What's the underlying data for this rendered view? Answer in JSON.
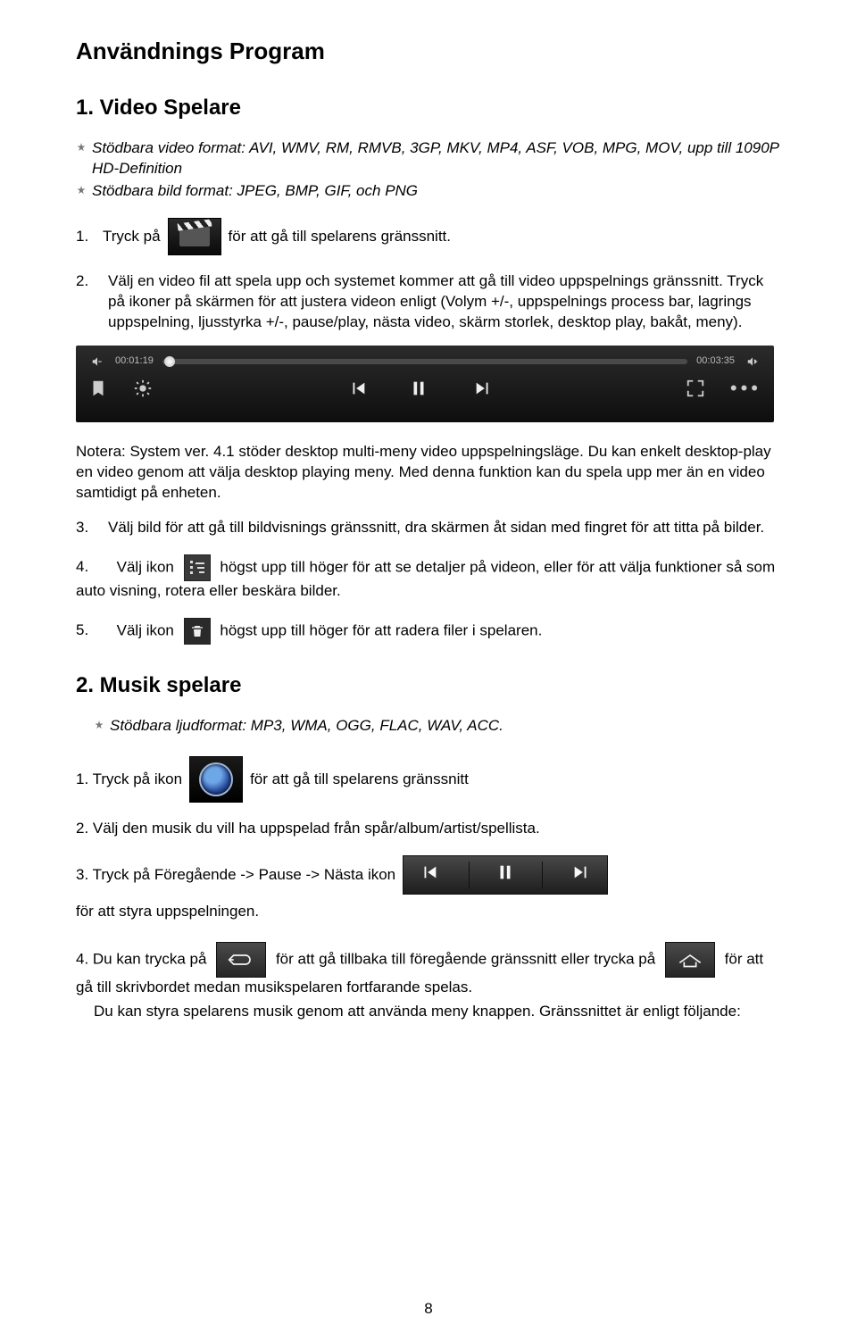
{
  "title": "Användnings Program",
  "section1": {
    "heading": "1. Video Spelare",
    "bullet1": "Stödbara video format: AVI, WMV, RM, RMVB, 3GP, MKV, MP4, ASF, VOB, MPG, MOV, upp till 1090P HD-Definition",
    "bullet2": "Stödbara bild format: JPEG, BMP, GIF, och PNG",
    "step1_a": "1.",
    "step1_b": "Tryck på",
    "step1_c": "för att gå till spelarens gränssnitt.",
    "step2_a": "2.",
    "step2_b": "Välj en video fil att spela upp och systemet kommer att gå till video uppspelnings gränssnitt. Tryck på ikoner på skärmen för att justera videon enligt (Volym +/-, uppspelnings process bar, lagrings uppspelning, ljusstyrka +/-, pause/play, nästa video, skärm storlek, desktop play, bakåt, meny).",
    "pb_time_left": "00:01:19",
    "pb_time_right": "00:03:35",
    "note": "Notera: System ver. 4.1 stöder desktop multi-meny video uppspelningsläge. Du kan enkelt desktop-play en video genom att välja desktop playing meny. Med denna funktion kan du spela upp mer än en video samtidigt på enheten.",
    "step3_a": "3.",
    "step3_b": "Välj bild för att gå till bildvisnings gränssnitt, dra skärmen åt sidan med fingret för att titta på bilder.",
    "step4_a": "4.",
    "step4_b": "Välj ikon",
    "step4_c": "högst upp till höger för att se detaljer på videon, eller för att välja funktioner så som auto visning, rotera eller beskära bilder.",
    "step5_a": "5.",
    "step5_b": "Välj ikon",
    "step5_c": "högst upp till höger för att radera filer i spelaren."
  },
  "section2": {
    "heading": "2. Musik spelare",
    "bullet1": "Stödbara ljudformat: MP3, WMA, OGG, FLAC, WAV, ACC.",
    "step1_a": "1. Tryck på ikon",
    "step1_b": "för att gå till spelarens gränssnitt",
    "step2": "2. Välj den musik du vill ha uppspelad från spår/album/artist/spellista.",
    "step3_a": "3. Tryck på Föregående -> Pause -> Nästa ikon",
    "step3_b": "för att styra uppspelningen.",
    "step4_a": "4. Du kan trycka på",
    "step4_b": "för att gå tillbaka till föregående gränssnitt eller trycka på",
    "step4_c": "för att gå till skrivbordet medan musikspelaren fortfarande spelas.",
    "step4_d": "Du kan styra spelarens musik genom att använda meny knappen. Gränssnittet är enligt följande:"
  },
  "page_number": "8"
}
